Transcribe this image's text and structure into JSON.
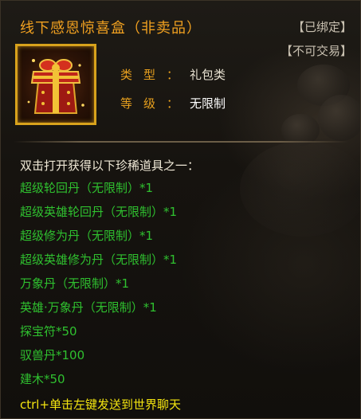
{
  "item": {
    "name": "线下感恩惊喜盒（非卖品）",
    "tags": {
      "bound": "【已绑定】",
      "untradable": "【不可交易】"
    },
    "icon": "gift-box-icon",
    "attributes": {
      "type_label": "类型：",
      "type_value": "礼包类",
      "level_label": "等级：",
      "level_value": "无限制"
    },
    "open_description": "双击打开获得以下珍稀道具之一：",
    "rewards": [
      "超级轮回丹（无限制）*1",
      "超级英雄轮回丹（无限制）*1",
      "超级修为丹（无限制）*1",
      "超级英雄修为丹（无限制）*1",
      "万象丹（无限制）*1",
      "英雄·万象丹（无限制）*1",
      "探宝符*50",
      "驭兽丹*100",
      "建木*50"
    ],
    "chat_tip": "ctrl+单击左键发送到世界聊天"
  },
  "colors": {
    "title": "#f0a020",
    "tag": "#c9c1b1",
    "attr_label": "#e8a01e",
    "reward": "#2fc02f",
    "chat_tip": "#f3e410",
    "frame": "#d8a21c"
  }
}
